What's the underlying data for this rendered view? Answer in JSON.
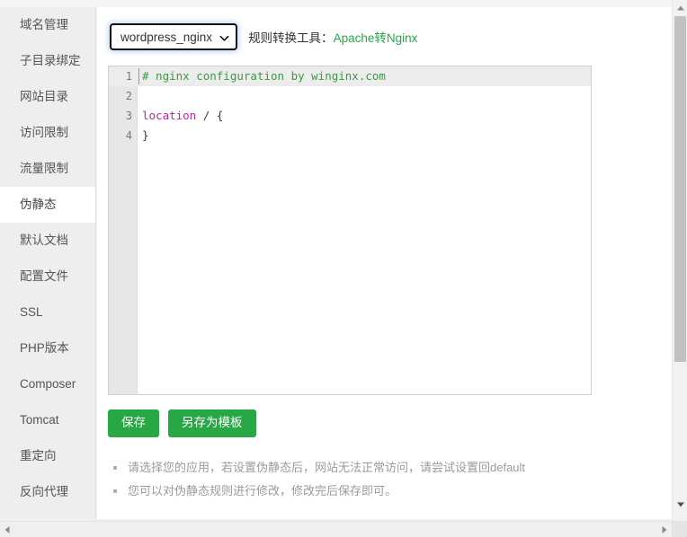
{
  "sidebar": {
    "items": [
      {
        "label": "域名管理",
        "active": false
      },
      {
        "label": "子目录绑定",
        "active": false
      },
      {
        "label": "网站目录",
        "active": false
      },
      {
        "label": "访问限制",
        "active": false
      },
      {
        "label": "流量限制",
        "active": false
      },
      {
        "label": "伪静态",
        "active": true
      },
      {
        "label": "默认文档",
        "active": false
      },
      {
        "label": "配置文件",
        "active": false
      },
      {
        "label": "SSL",
        "active": false
      },
      {
        "label": "PHP版本",
        "active": false
      },
      {
        "label": "Composer",
        "active": false
      },
      {
        "label": "Tomcat",
        "active": false
      },
      {
        "label": "重定向",
        "active": false
      },
      {
        "label": "反向代理",
        "active": false
      }
    ]
  },
  "toolbar": {
    "rule_select": {
      "selected": "wordpress_nginx",
      "icon": "chevron-down-icon"
    },
    "converter_label": "规则转换工具：",
    "converter_link": "Apache转Nginx",
    "converter_link_color": "#27a745"
  },
  "editor": {
    "lines": [
      {
        "number": "1",
        "highlighted": true,
        "tokens": [
          {
            "text": "# nginx configuration by winginx.com",
            "type": "comment"
          }
        ]
      },
      {
        "number": "2",
        "highlighted": false,
        "tokens": [
          {
            "text": "",
            "type": "plain"
          }
        ]
      },
      {
        "number": "3",
        "highlighted": false,
        "tokens": [
          {
            "text": "location",
            "type": "keyword"
          },
          {
            "text": " / {",
            "type": "plain"
          }
        ]
      },
      {
        "number": "4",
        "highlighted": false,
        "tokens": [
          {
            "text": "}",
            "type": "plain"
          }
        ]
      }
    ],
    "comment_color": "#3c9a44",
    "keyword_color": "#b5289e"
  },
  "actions": {
    "save_label": "保存",
    "save_as_template_label": "另存为模板",
    "button_color": "#28a745"
  },
  "notes": [
    "请选择您的应用，若设置伪静态后，网站无法正常访问，请尝试设置回default",
    "您可以对伪静态规则进行修改，修改完后保存即可。"
  ],
  "scrollbars": {
    "vertical_up_icon": "triangle-up-icon",
    "vertical_down_icon": "triangle-down-icon",
    "horizontal_left_icon": "triangle-left-icon",
    "horizontal_right_icon": "triangle-right-icon"
  }
}
